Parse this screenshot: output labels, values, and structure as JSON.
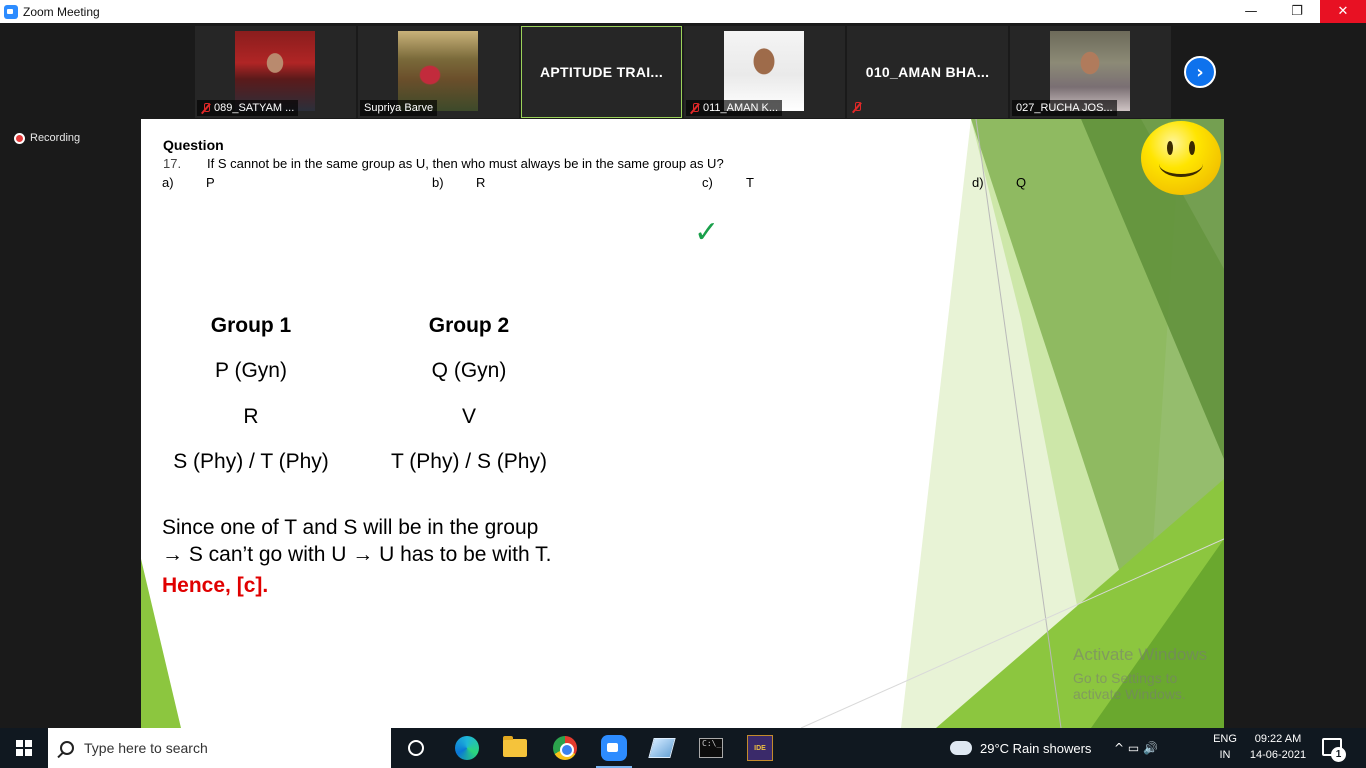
{
  "window": {
    "title": "Zoom Meeting",
    "minimize": "—",
    "maximize": "❐",
    "close": "✕"
  },
  "participants": [
    {
      "name": "089_SATYAM ...",
      "muted": true,
      "video": true
    },
    {
      "name": "Supriya Barve",
      "muted": false,
      "video": true
    },
    {
      "name": "APTITUDE TRAI...",
      "muted": false,
      "video": false,
      "active": true
    },
    {
      "name": "011_AMAN K...",
      "muted": true,
      "video": true
    },
    {
      "name": "010_AMAN BHA...",
      "muted": true,
      "video": false
    },
    {
      "name": "027_RUCHA JOS...",
      "muted": false,
      "video": true
    }
  ],
  "next_arrow": "›",
  "recording": "Recording",
  "slide": {
    "heading": "Question",
    "number": "17.",
    "question": "If S cannot be in the same group as U, then who must always be in the same  group as U?",
    "options": [
      {
        "letter": "a)",
        "value": "P"
      },
      {
        "letter": "b)",
        "value": "R"
      },
      {
        "letter": "c)",
        "value": "T"
      },
      {
        "letter": "d)",
        "value": "Q"
      }
    ],
    "checkmark": "✓",
    "groups": {
      "group1_title": "Group 1",
      "group2_title": "Group 2",
      "group1": [
        "P (Gyn)",
        "R",
        "S (Phy) / T (Phy)"
      ],
      "group2": [
        "Q (Gyn)",
        "V",
        "T (Phy) / S (Phy)"
      ]
    },
    "explanation_line1": "Since one of T and S will be in the group",
    "explanation_line2": "→ S can’t go with U → U has to be with T.",
    "conclusion": "Hence, [c].",
    "watermark_title": "Activate Windows",
    "watermark_sub": "Go to Settings to activate Windows."
  },
  "taskbar": {
    "search_placeholder": "Type here to search",
    "weather": "29°C  Rain showers",
    "tray_icons": "^  ▭  🔊",
    "lang_top": "ENG",
    "lang_bottom": "IN",
    "time": "09:22 AM",
    "date": "14-06-2021",
    "notifications": "1"
  }
}
